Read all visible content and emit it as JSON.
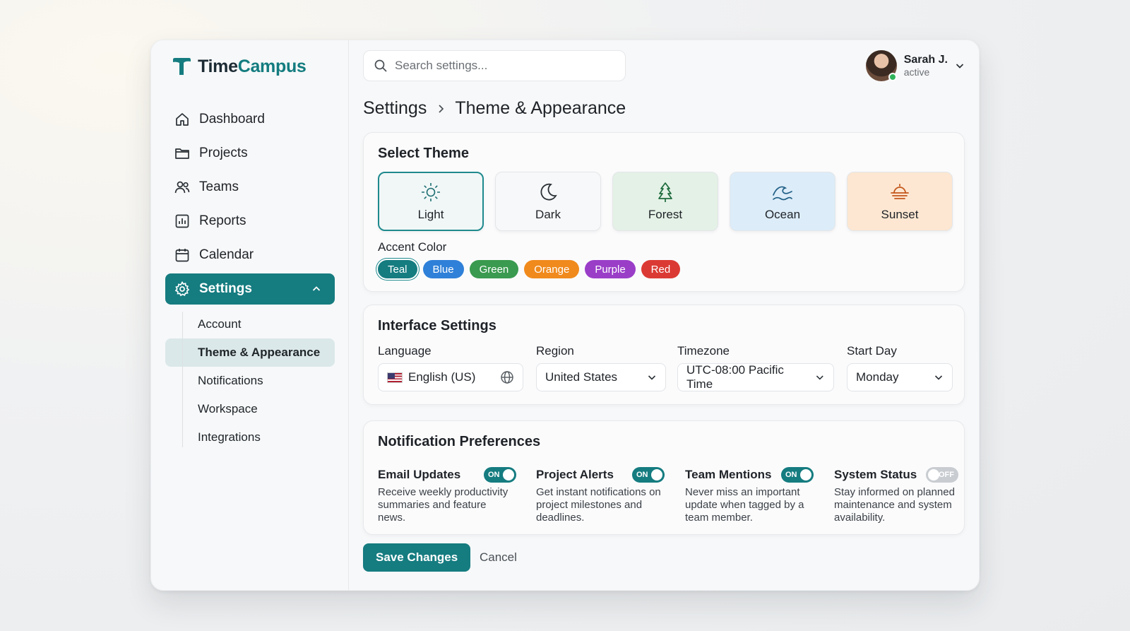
{
  "app": {
    "name_part1": "Time",
    "name_part2": "Campus",
    "brand_color": "#157c80"
  },
  "search": {
    "placeholder": "Search settings..."
  },
  "user": {
    "name": "Sarah J.",
    "status": "active"
  },
  "sidebar": {
    "items": [
      {
        "label": "Dashboard",
        "icon": "home-icon"
      },
      {
        "label": "Projects",
        "icon": "folder-icon"
      },
      {
        "label": "Teams",
        "icon": "users-icon"
      },
      {
        "label": "Reports",
        "icon": "chart-icon"
      },
      {
        "label": "Calendar",
        "icon": "calendar-icon"
      },
      {
        "label": "Settings",
        "icon": "gear-icon",
        "active": true
      }
    ],
    "sub_items": [
      {
        "label": "Account"
      },
      {
        "label": "Theme & Appearance",
        "active": true
      },
      {
        "label": "Notifications"
      },
      {
        "label": "Workspace"
      },
      {
        "label": "Integrations"
      }
    ]
  },
  "breadcrumb": {
    "parent": "Settings",
    "current": "Theme & Appearance"
  },
  "theme_section": {
    "title": "Select Theme",
    "themes": [
      {
        "label": "Light",
        "icon": "sun-icon",
        "selected": true
      },
      {
        "label": "Dark",
        "icon": "moon-icon"
      },
      {
        "label": "Forest",
        "icon": "tree-icon"
      },
      {
        "label": "Ocean",
        "icon": "wave-icon"
      },
      {
        "label": "Sunset",
        "icon": "sunset-icon"
      }
    ],
    "accent_label": "Accent Color",
    "accents": [
      {
        "label": "Teal",
        "color": "#157c80",
        "selected": true
      },
      {
        "label": "Blue",
        "color": "#2f80d8"
      },
      {
        "label": "Green",
        "color": "#3a9a4f"
      },
      {
        "label": "Orange",
        "color": "#f08a1c"
      },
      {
        "label": "Purple",
        "color": "#9a3ec8"
      },
      {
        "label": "Red",
        "color": "#db3a34"
      }
    ]
  },
  "interface": {
    "title": "Interface Settings",
    "language": {
      "label": "Language",
      "value": "English (US)"
    },
    "region": {
      "label": "Region",
      "value": "United States"
    },
    "timezone": {
      "label": "Timezone",
      "value": "UTC-08:00 Pacific Time"
    },
    "start_day": {
      "label": "Start Day",
      "value": "Monday"
    }
  },
  "notifications": {
    "title": "Notification Preferences",
    "items": [
      {
        "title": "Email Updates",
        "state": "ON",
        "desc": "Receive weekly productivity summaries and feature news."
      },
      {
        "title": "Project Alerts",
        "state": "ON",
        "desc": "Get instant notifications on project milestones and deadlines."
      },
      {
        "title": "Team Mentions",
        "state": "ON",
        "desc": "Never miss an important update when tagged by a team member."
      },
      {
        "title": "System Status",
        "state": "OFF",
        "desc": "Stay informed on planned maintenance and system availability."
      }
    ]
  },
  "actions": {
    "save": "Save Changes",
    "cancel": "Cancel"
  }
}
